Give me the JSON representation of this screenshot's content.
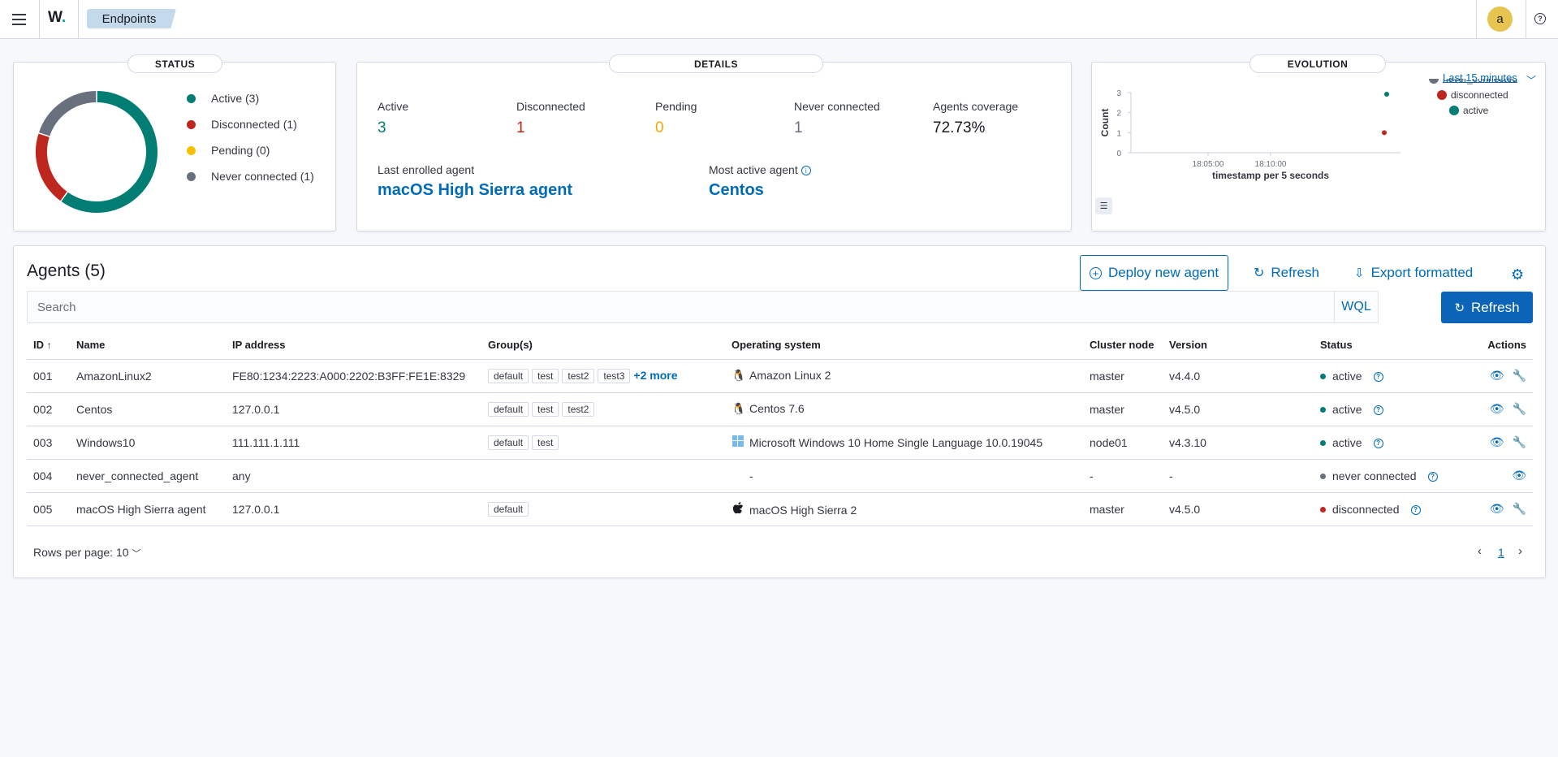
{
  "header": {
    "logo": "W.",
    "breadcrumb": "Endpoints",
    "avatar": "a",
    "help": "?"
  },
  "status_panel": {
    "title": "STATUS",
    "legend": [
      {
        "label": "Active (3)",
        "color": "#017d73"
      },
      {
        "label": "Disconnected (1)",
        "color": "#bd271e"
      },
      {
        "label": "Pending (0)",
        "color": "#f5a700"
      },
      {
        "label": "Never connected (1)",
        "color": "#69707d"
      }
    ],
    "chart_data": {
      "type": "pie",
      "categories": [
        "Active",
        "Disconnected",
        "Pending",
        "Never connected"
      ],
      "values": [
        3,
        1,
        0,
        1
      ],
      "colors": [
        "#017d73",
        "#bd271e",
        "#f5a700",
        "#69707d"
      ]
    }
  },
  "details_panel": {
    "title": "DETAILS",
    "stats": [
      {
        "label": "Active",
        "value": "3",
        "color": "#017d73"
      },
      {
        "label": "Disconnected",
        "value": "1",
        "color": "#bd271e"
      },
      {
        "label": "Pending",
        "value": "0",
        "color": "#f5a700"
      },
      {
        "label": "Never connected",
        "value": "1",
        "color": "#69707d"
      },
      {
        "label": "Agents coverage",
        "value": "72.73%",
        "color": "#1a1c21"
      }
    ],
    "last_enrolled_label": "Last enrolled agent",
    "last_enrolled_value": "macOS High Sierra agent",
    "most_active_label": "Most active agent",
    "most_active_value": "Centos"
  },
  "evolution_panel": {
    "title": "EVOLUTION",
    "time_range": "Last 15 minutes",
    "chart_data": {
      "type": "scatter",
      "ylabel": "Count",
      "xlabel": "timestamp per 5 seconds",
      "yticks": [
        "0",
        "1",
        "2",
        "3"
      ],
      "xticks": [
        "18:05:00",
        "18:10:00"
      ],
      "ylim": [
        0,
        3
      ],
      "series": [
        {
          "name": "never_connected",
          "color": "#69707d",
          "values": []
        },
        {
          "name": "disconnected",
          "color": "#bd271e",
          "values": [
            1
          ]
        },
        {
          "name": "active",
          "color": "#017d73",
          "values": [
            3
          ]
        }
      ]
    }
  },
  "agents": {
    "title": "Agents (5)",
    "deploy_label": "Deploy new agent",
    "refresh_label": "Refresh",
    "export_label": "Export formatted",
    "search_placeholder": "Search",
    "wql_label": "WQL",
    "refresh_button_label": "Refresh",
    "columns": [
      "ID",
      "Name",
      "IP address",
      "Group(s)",
      "Operating system",
      "Cluster node",
      "Version",
      "Status",
      "Actions"
    ],
    "rows": [
      {
        "id": "001",
        "name": "AmazonLinux2",
        "ip": "FE80:1234:2223:A000:2202:B3FF:FE1E:8329",
        "groups": [
          "default",
          "test",
          "test2",
          "test3"
        ],
        "more": "+2 more",
        "os_icon": "linux-icon",
        "os": "Amazon Linux 2",
        "node": "master",
        "version": "v4.4.0",
        "status": "active",
        "status_color": "#017d73",
        "actions": 2
      },
      {
        "id": "002",
        "name": "Centos",
        "ip": "127.0.0.1",
        "groups": [
          "default",
          "test",
          "test2"
        ],
        "more": "",
        "os_icon": "linux-icon",
        "os": "Centos 7.6",
        "node": "master",
        "version": "v4.5.0",
        "status": "active",
        "status_color": "#017d73",
        "actions": 2
      },
      {
        "id": "003",
        "name": "Windows10",
        "ip": "111.111.1.111",
        "groups": [
          "default",
          "test"
        ],
        "more": "",
        "os_icon": "windows-icon",
        "os": "Microsoft Windows 10 Home Single Language 10.0.19045",
        "node": "node01",
        "version": "v4.3.10",
        "status": "active",
        "status_color": "#017d73",
        "actions": 2
      },
      {
        "id": "004",
        "name": "never_connected_agent",
        "ip": "any",
        "groups": [],
        "more": "",
        "os_icon": "",
        "os": "-",
        "node": "-",
        "version": "-",
        "status": "never connected",
        "status_color": "#69707d",
        "actions": 1
      },
      {
        "id": "005",
        "name": "macOS High Sierra agent",
        "ip": "127.0.0.1",
        "groups": [
          "default"
        ],
        "more": "",
        "os_icon": "apple-icon",
        "os": "macOS High Sierra 2",
        "node": "master",
        "version": "v4.5.0",
        "status": "disconnected",
        "status_color": "#bd271e",
        "actions": 2
      }
    ],
    "rows_per_page": "Rows per page: 10",
    "current_page": "1"
  }
}
